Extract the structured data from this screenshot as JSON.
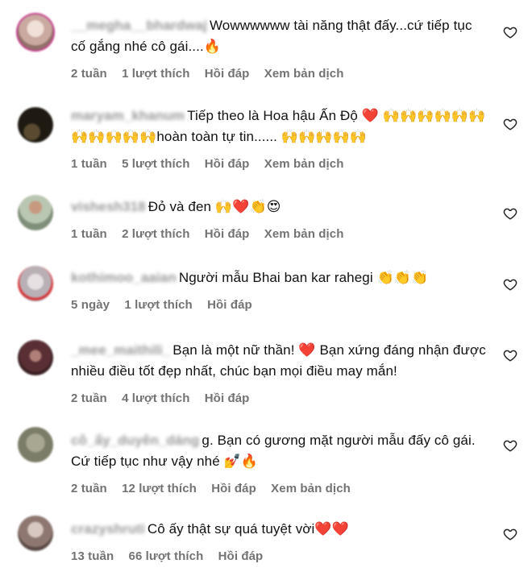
{
  "comments": [
    {
      "username": "__megha__bhardwaj",
      "text": "Wowwwwww tài năng thật đấy...cứ tiếp tục cố gắng nhé cô gái....🔥",
      "time": "2 tuần",
      "likes": "1 lượt thích",
      "reply": "Hồi đáp",
      "translate": "Xem bản dịch",
      "avatar_color": "#d9c2b8"
    },
    {
      "username": "maryam_khanum",
      "text": "Tiếp theo là Hoa hậu Ấn Độ ❤️ 🙌🙌🙌🙌🙌🙌🙌🙌🙌🙌🙌hoàn toàn tự tin...... 🙌🙌🙌🙌🙌",
      "time": "1 tuần",
      "likes": "5 lượt thích",
      "reply": "Hồi đáp",
      "translate": "Xem bản dịch",
      "avatar_color": "#2a2418"
    },
    {
      "username": "vishesh318",
      "text": "Đỏ và đen 🙌❤️👏😍",
      "time": "1 tuần",
      "likes": "2 lượt thích",
      "reply": "Hồi đáp",
      "translate": "Xem bản dịch",
      "avatar_color": "#a9b7a0"
    },
    {
      "username": "kothimoo_aaian",
      "text": "Người mẫu Bhai ban kar rahegi 👏👏👏",
      "time": "5 ngày",
      "likes": "1 lượt thích",
      "reply": "Hồi đáp",
      "translate": "",
      "avatar_color": "#c9c4c8"
    },
    {
      "username": "_mee_maithili_",
      "text": "Bạn là một nữ thần! ❤️ Bạn xứng đáng nhận được nhiều điều tốt đẹp nhất, chúc bạn mọi điều may mắn!",
      "time": "2 tuần",
      "likes": "4 lượt thích",
      "reply": "Hồi đáp",
      "translate": "",
      "avatar_color": "#6b3a3f"
    },
    {
      "username": "cô_ấy_duyên_dáng",
      "text": "g. Bạn có gương mặt người mẫu đấy cô gái. Cứ tiếp tục như vậy nhé 💅🔥",
      "time": "2 tuần",
      "likes": "12 lượt thích",
      "reply": "Hồi đáp",
      "translate": "Xem bản dịch",
      "avatar_color": "#9a9a86"
    },
    {
      "username": "crazyshruti",
      "text": "Cô ấy thật sự quá tuyệt vời❤️❤️",
      "time": "13 tuần",
      "likes": "66 lượt thích",
      "reply": "Hồi đáp",
      "translate": "",
      "avatar_color": "#b8a49c"
    }
  ]
}
